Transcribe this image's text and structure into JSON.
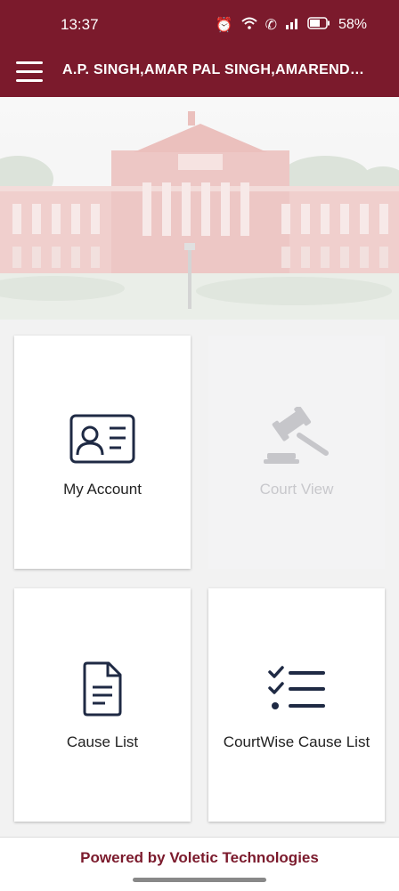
{
  "status": {
    "time": "13:37",
    "battery": "58%"
  },
  "header": {
    "title": "A.P. SINGH,AMAR PAL SINGH,AMARENDRA KUMAR SINGH"
  },
  "tiles": [
    {
      "label": "My Account",
      "icon": "id-card-icon",
      "enabled": true
    },
    {
      "label": "Court View",
      "icon": "gavel-icon",
      "enabled": false
    },
    {
      "label": "Cause List",
      "icon": "document-icon",
      "enabled": true
    },
    {
      "label": "CourtWise Cause List",
      "icon": "checklist-icon",
      "enabled": true
    }
  ],
  "colors": {
    "brand": "#7b1a2c",
    "icon": "#1f2a44"
  },
  "footer": {
    "text": "Powered by Voletic Technologies"
  }
}
